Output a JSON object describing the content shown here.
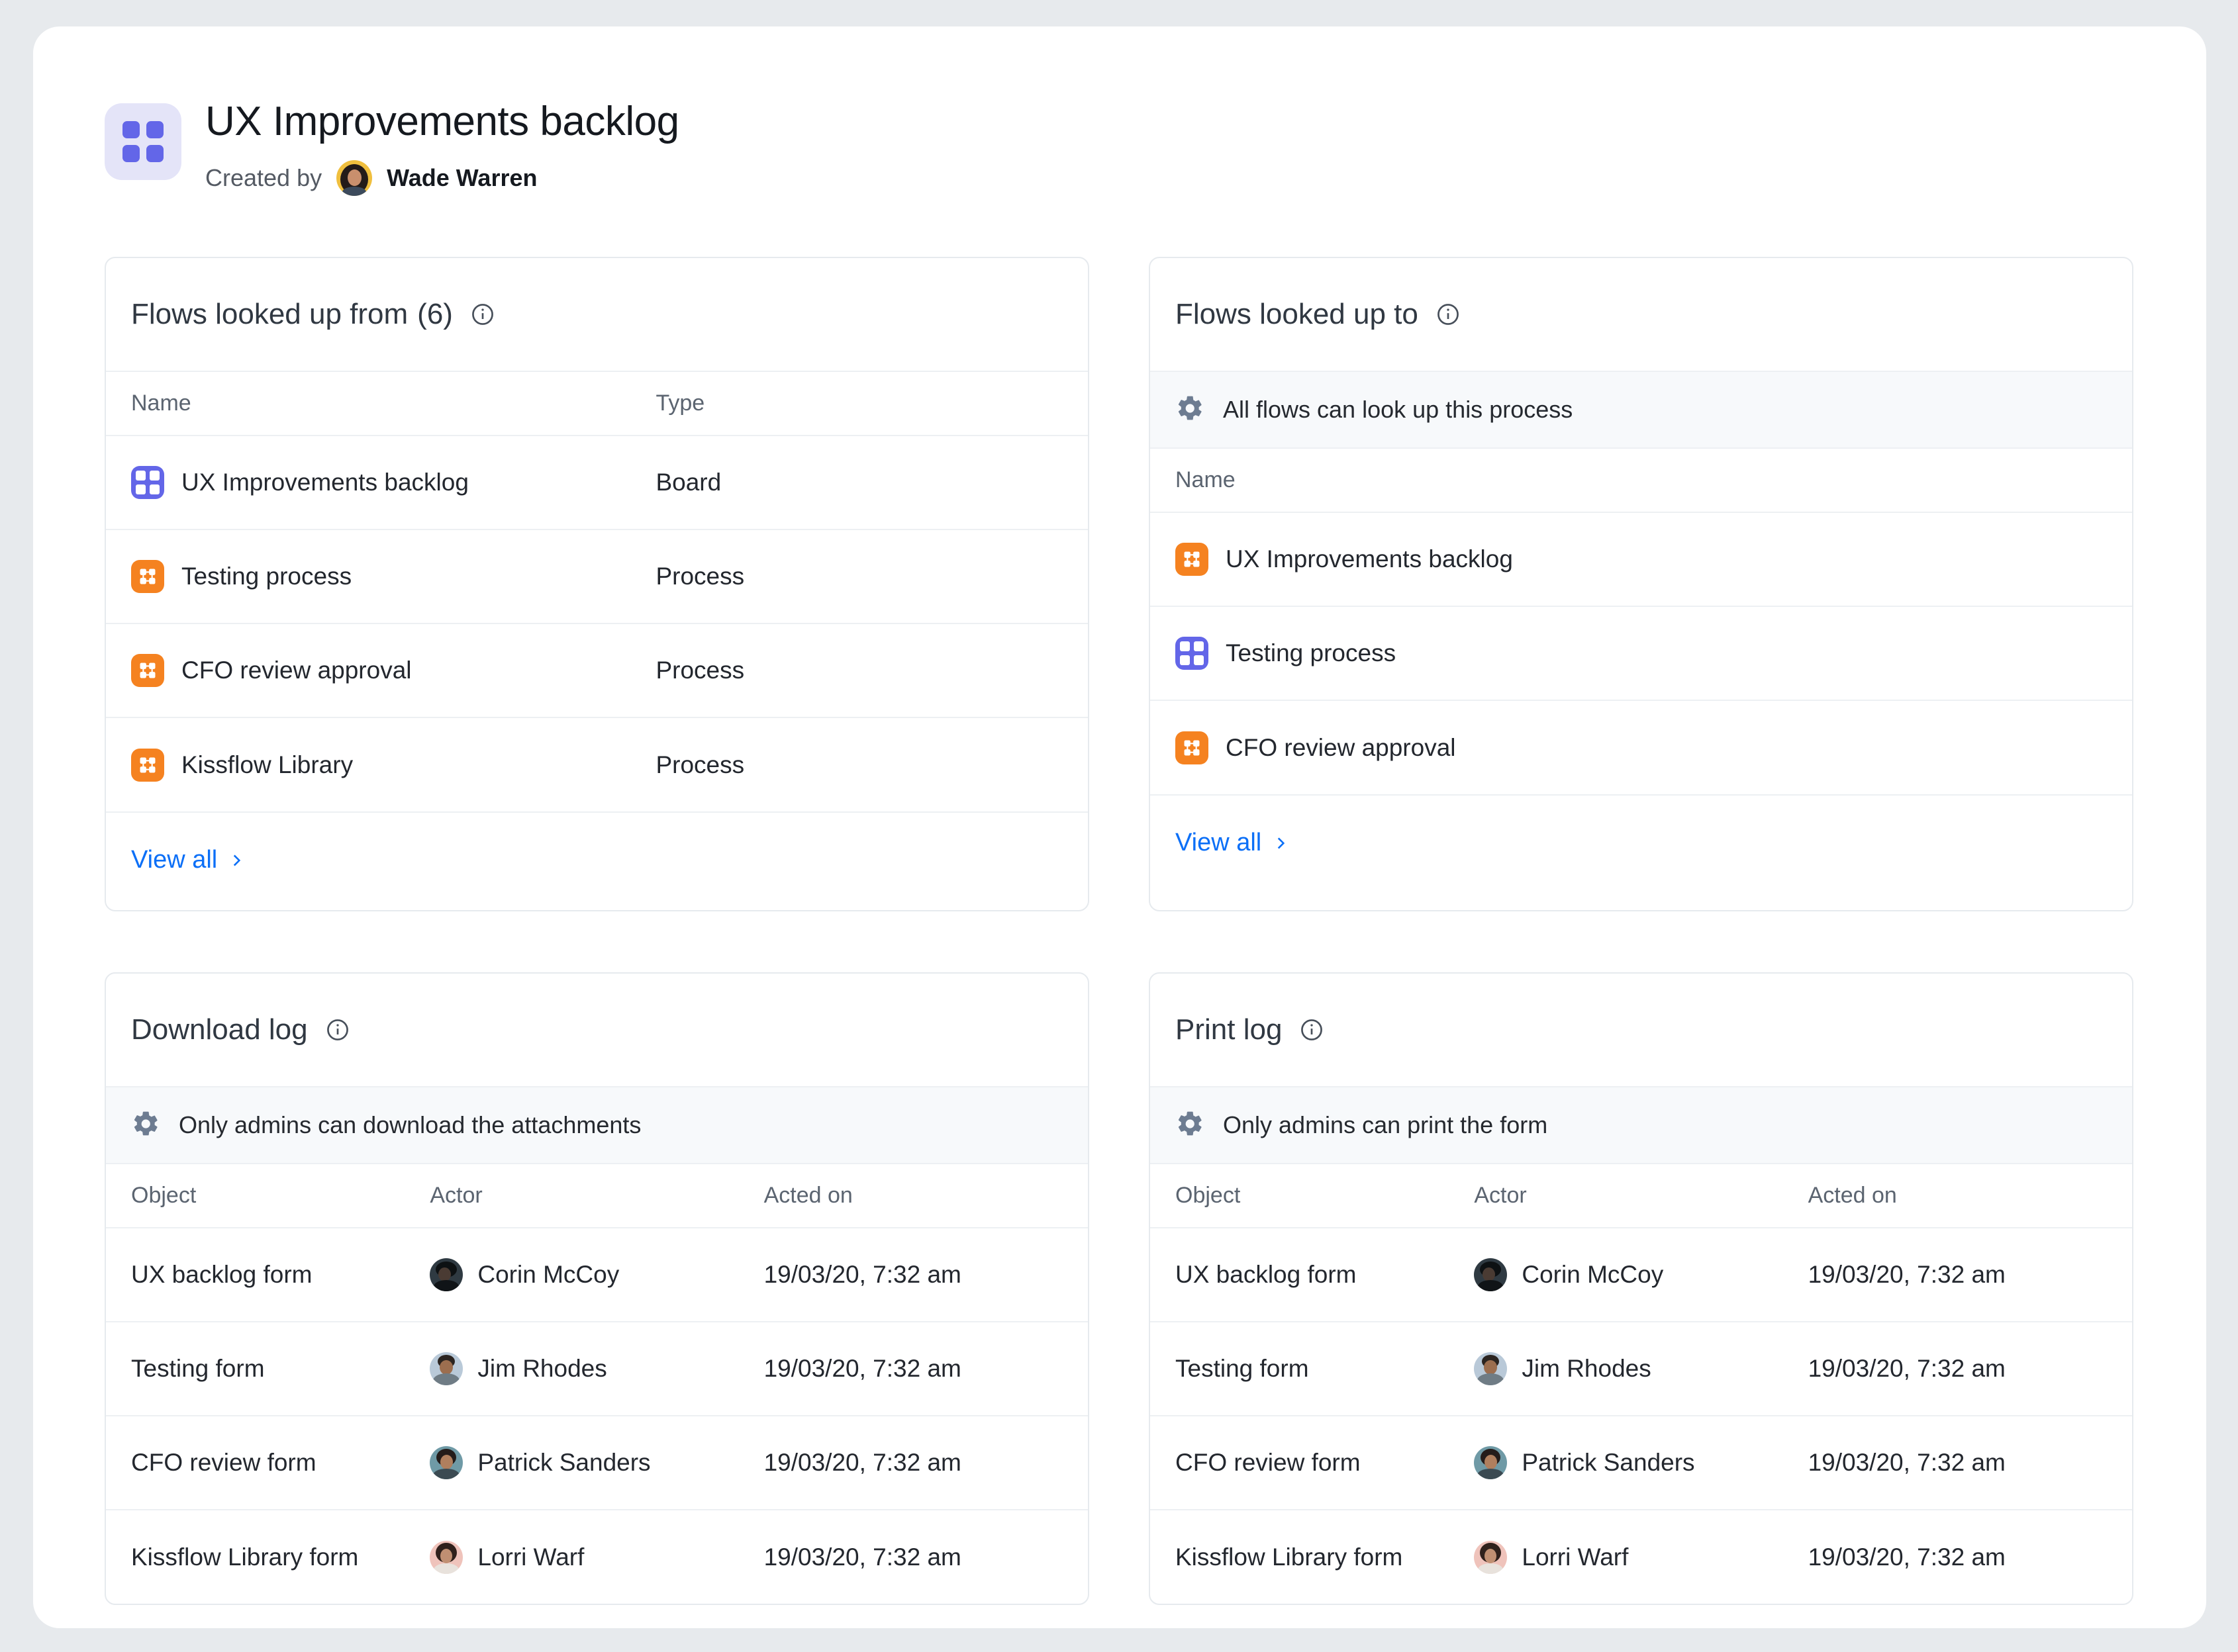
{
  "header": {
    "title": "UX Improvements backlog",
    "created_by_label": "Created by",
    "creator": "Wade Warren",
    "app_icon": "board-grid-icon",
    "avatar_colors": {
      "bg": "#f0bf3e",
      "hair": "#221a18",
      "skin": "#c98f6d"
    }
  },
  "colors": {
    "board_icon": "#6366e8",
    "process_icon": "#f58220",
    "link": "#0b6ff7",
    "notice_bg": "#f7f9fb",
    "page_bg": "#e7eaed",
    "border": "#e6eaee"
  },
  "cards": {
    "looked_up_from": {
      "title": "Flows looked up from",
      "count": "(6)",
      "info_icon": "info-circle-icon",
      "columns": [
        "Name",
        "Type"
      ],
      "rows": [
        {
          "name": "UX Improvements backlog",
          "type": "Board",
          "icon": "board"
        },
        {
          "name": "Testing process",
          "type": "Process",
          "icon": "process"
        },
        {
          "name": "CFO review approval",
          "type": "Process",
          "icon": "process"
        },
        {
          "name": "Kissflow Library",
          "type": "Process",
          "icon": "process"
        }
      ],
      "view_all": "View all"
    },
    "looked_up_to": {
      "title": "Flows looked up to",
      "count": "",
      "info_icon": "info-circle-icon",
      "notice": "All flows can look up this process",
      "notice_icon": "gear-icon",
      "columns": [
        "Name"
      ],
      "rows": [
        {
          "name": "UX Improvements backlog",
          "icon": "process"
        },
        {
          "name": "Testing process",
          "icon": "board"
        },
        {
          "name": "CFO review approval",
          "icon": "process"
        }
      ],
      "view_all": "View all"
    },
    "download_log": {
      "title": "Download log",
      "info_icon": "info-circle-icon",
      "notice": "Only admins can download the attachments",
      "notice_icon": "gear-icon",
      "columns": [
        "Object",
        "Actor",
        "Acted on"
      ],
      "rows": [
        {
          "object": "UX backlog form",
          "actor": "Corin McCoy",
          "acted_on": "19/03/20, 7:32 am",
          "avatar": "corin"
        },
        {
          "object": "Testing form",
          "actor": "Jim Rhodes",
          "acted_on": "19/03/20, 7:32 am",
          "avatar": "jim"
        },
        {
          "object": "CFO review form",
          "actor": "Patrick Sanders",
          "acted_on": "19/03/20, 7:32 am",
          "avatar": "patrick"
        },
        {
          "object": "Kissflow Library form",
          "actor": "Lorri Warf",
          "acted_on": "19/03/20, 7:32 am",
          "avatar": "lorri"
        }
      ]
    },
    "print_log": {
      "title": "Print log",
      "info_icon": "info-circle-icon",
      "notice": "Only admins can print the form",
      "notice_icon": "gear-icon",
      "columns": [
        "Object",
        "Actor",
        "Acted on"
      ],
      "rows": [
        {
          "object": "UX backlog form",
          "actor": "Corin McCoy",
          "acted_on": "19/03/20, 7:32 am",
          "avatar": "corin"
        },
        {
          "object": "Testing form",
          "actor": "Jim Rhodes",
          "acted_on": "19/03/20, 7:32 am",
          "avatar": "jim"
        },
        {
          "object": "CFO review form",
          "actor": "Patrick Sanders",
          "acted_on": "19/03/20, 7:32 am",
          "avatar": "patrick"
        },
        {
          "object": "Kissflow Library form",
          "actor": "Lorri Warf",
          "acted_on": "19/03/20, 7:32 am",
          "avatar": "lorri"
        }
      ]
    }
  }
}
